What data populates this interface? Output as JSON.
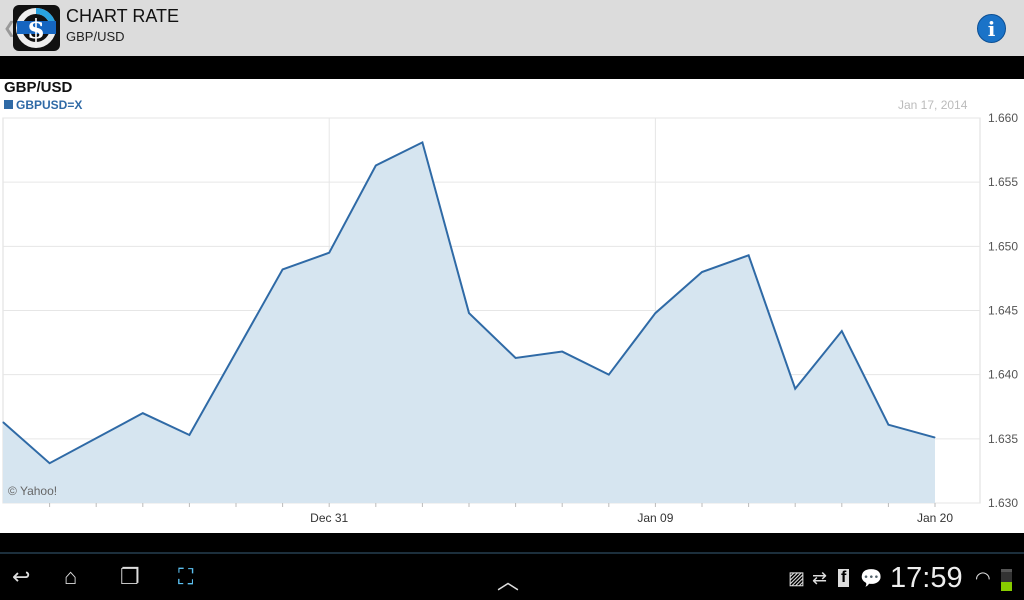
{
  "app": {
    "title": "CHART RATE",
    "subtitle": "GBP/USD",
    "logo_text": "£€$¥$"
  },
  "chart_data": {
    "type": "area",
    "title": "GBP/USD",
    "legend": "GBPUSD=X",
    "date": "Jan 17, 2014",
    "credit": "© Yahoo!",
    "xlabel": "",
    "ylabel": "",
    "ylim": [
      1.63,
      1.66
    ],
    "yticks": [
      "1.660",
      "1.655",
      "1.650",
      "1.645",
      "1.640",
      "1.635",
      "1.630"
    ],
    "xticks": [
      {
        "label": "Dec 31",
        "index": 7
      },
      {
        "label": "Jan 09",
        "index": 14
      },
      {
        "label": "Jan 20",
        "index": 20
      }
    ],
    "x_slots": 21,
    "series": [
      {
        "name": "GBPUSD=X",
        "color": "#2f6aa6",
        "points": [
          [
            0,
            1.6363
          ],
          [
            1,
            1.6331
          ],
          [
            3,
            1.637
          ],
          [
            4,
            1.6353
          ],
          [
            6,
            1.6482
          ],
          [
            7,
            1.6495
          ],
          [
            8,
            1.6563
          ],
          [
            9,
            1.6581
          ],
          [
            10,
            1.6448
          ],
          [
            11,
            1.6413
          ],
          [
            12,
            1.6418
          ],
          [
            13,
            1.64
          ],
          [
            14,
            1.6448
          ],
          [
            15,
            1.648
          ],
          [
            16,
            1.6493
          ],
          [
            17,
            1.6389
          ],
          [
            18,
            1.6434
          ],
          [
            19,
            1.6361
          ],
          [
            20,
            1.6351
          ]
        ]
      }
    ]
  },
  "status": {
    "time": "17:59"
  }
}
